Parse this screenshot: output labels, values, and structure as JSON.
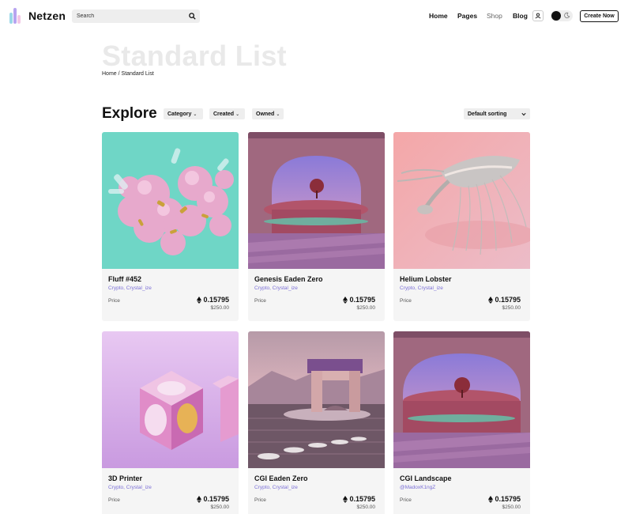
{
  "brand": {
    "name": "Netzen"
  },
  "search": {
    "placeholder": "Search"
  },
  "nav": {
    "home": "Home",
    "pages": "Pages",
    "shop": "Shop",
    "blog": "Blog"
  },
  "header": {
    "create_label": "Create Now"
  },
  "page": {
    "title": "Standard List",
    "breadcrumb": {
      "home": "Home",
      "separator": " / ",
      "current": "Standard List"
    }
  },
  "explore": {
    "title": "Explore",
    "filters": {
      "category": "Category",
      "created": "Created",
      "owned": "Owned"
    },
    "sort": "Default sorting"
  },
  "cards": [
    {
      "name": "Fluff #452",
      "tags": "Crypto, Crystal_ize",
      "price_label": "Price",
      "price": "0.15795",
      "usd": "$250.00"
    },
    {
      "name": "Genesis Eaden Zero",
      "tags": "Crypto, Crystal_ize",
      "price_label": "Price",
      "price": "0.15795",
      "usd": "$250.00"
    },
    {
      "name": "Helium Lobster",
      "tags": "Crypto, Crystal_ize",
      "price_label": "Price",
      "price": "0.15795",
      "usd": "$250.00"
    },
    {
      "name": "3D Printer",
      "tags": "Crypto, Crystal_ize",
      "price_label": "Price",
      "price": "0.15795",
      "usd": "$250.00"
    },
    {
      "name": "CGI Eaden Zero",
      "tags": "Crypto, Crystal_ize",
      "price_label": "Price",
      "price": "0.15795",
      "usd": "$250.00"
    },
    {
      "name": "CGI Landscape",
      "tags": "@MadoxK1ngZ",
      "price_label": "Price",
      "price": "0.15795",
      "usd": "$250.00"
    }
  ],
  "colors": {
    "accent": "#7b6fd6",
    "page_title": "#e9e9e9",
    "card_bg": "#f5f5f5"
  }
}
